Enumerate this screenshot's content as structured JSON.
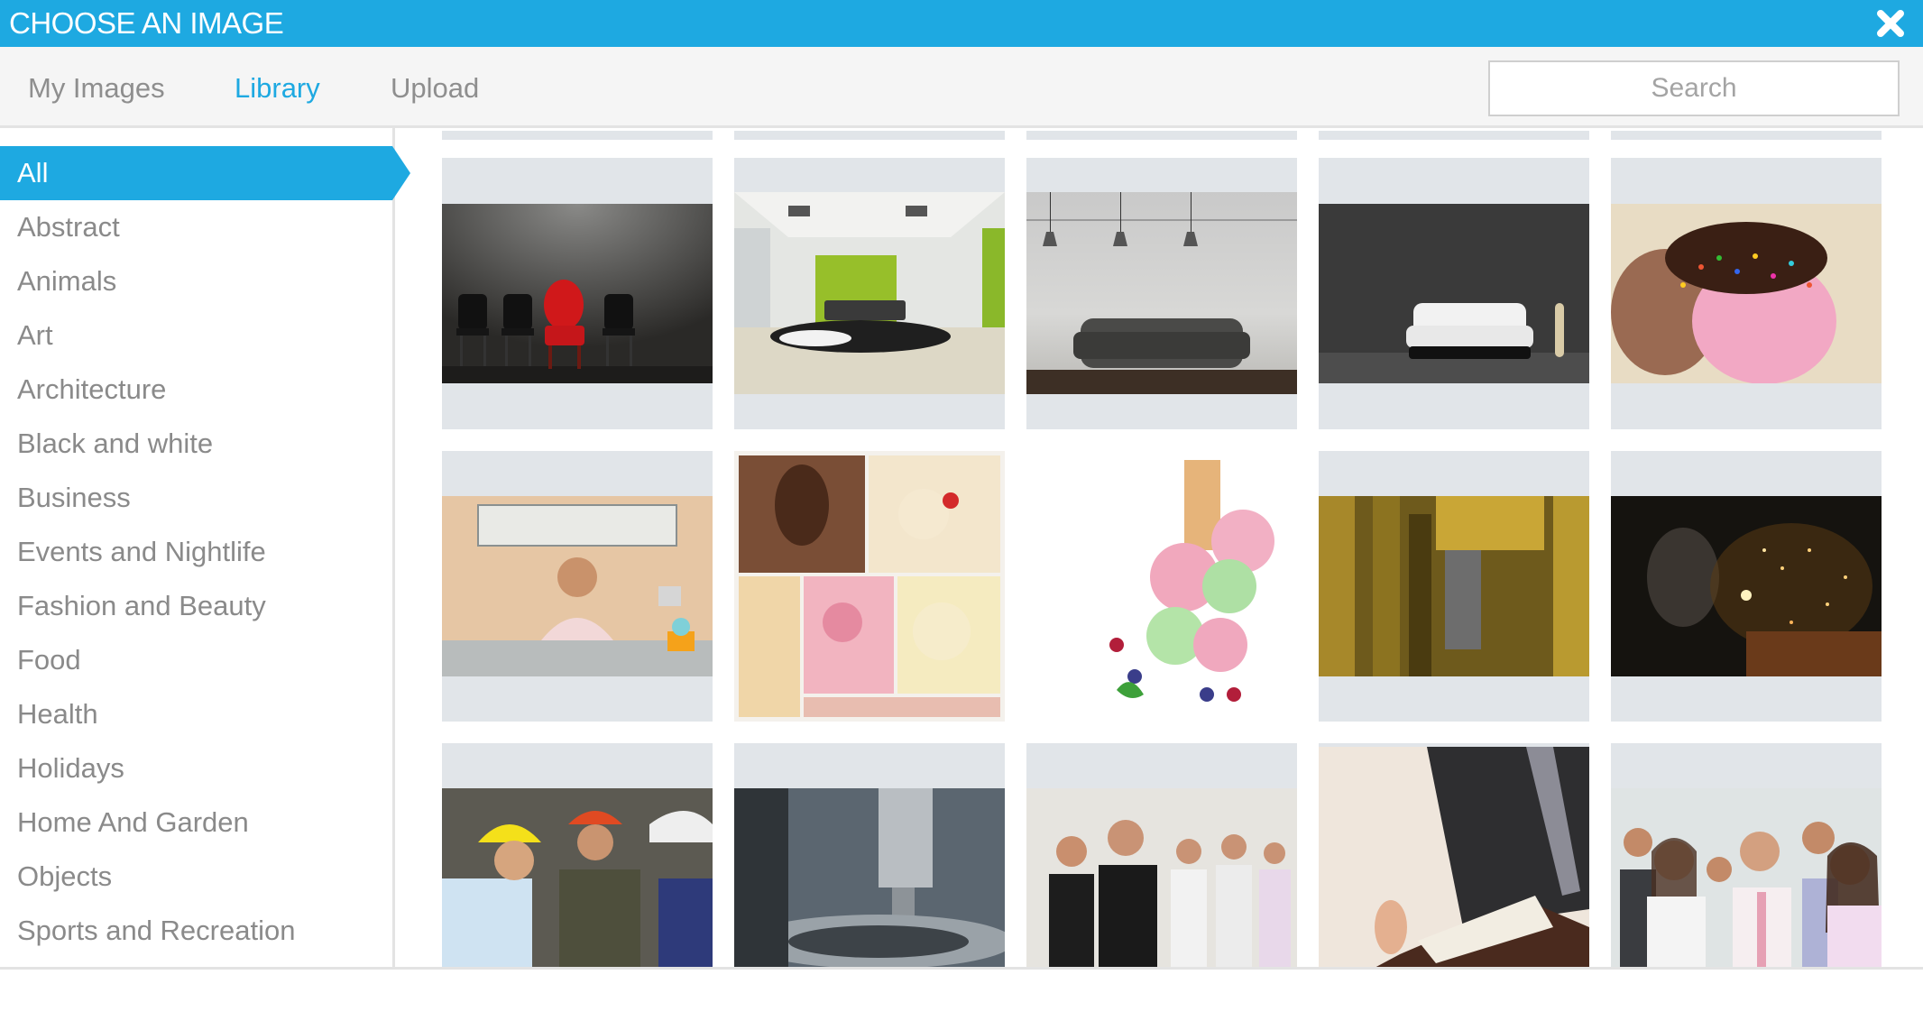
{
  "dialog": {
    "title": "CHOOSE AN IMAGE",
    "close_icon": "close-icon",
    "accent_color": "#1EA9E1"
  },
  "tabs": [
    {
      "label": "My Images",
      "active": false
    },
    {
      "label": "Library",
      "active": true
    },
    {
      "label": "Upload",
      "active": false
    }
  ],
  "search": {
    "placeholder": "Search",
    "value": ""
  },
  "categories": [
    {
      "label": "All",
      "active": true
    },
    {
      "label": "Abstract"
    },
    {
      "label": "Animals"
    },
    {
      "label": "Art"
    },
    {
      "label": "Architecture"
    },
    {
      "label": "Black and white"
    },
    {
      "label": "Business"
    },
    {
      "label": "Events and Nightlife"
    },
    {
      "label": "Fashion and Beauty"
    },
    {
      "label": "Food"
    },
    {
      "label": "Health"
    },
    {
      "label": "Holidays"
    },
    {
      "label": "Home And Garden"
    },
    {
      "label": "Objects"
    },
    {
      "label": "Sports and Recreation"
    }
  ],
  "images": [
    {
      "subject": "red armchair among black chairs"
    },
    {
      "subject": "modern living room with green wall"
    },
    {
      "subject": "leather sofa under pendant lamps"
    },
    {
      "subject": "white sofa against dark wall"
    },
    {
      "subject": "ice cream with sprinkles"
    },
    {
      "subject": "woman at ice cream counter"
    },
    {
      "subject": "ice cream collage"
    },
    {
      "subject": "ice cream scoops with berries"
    },
    {
      "subject": "industrial machinery"
    },
    {
      "subject": "welder with sparks"
    },
    {
      "subject": "workers in hard hats"
    },
    {
      "subject": "drilling machine"
    },
    {
      "subject": "business team"
    },
    {
      "subject": "businessman reading document"
    },
    {
      "subject": "group of business people looking up"
    }
  ]
}
